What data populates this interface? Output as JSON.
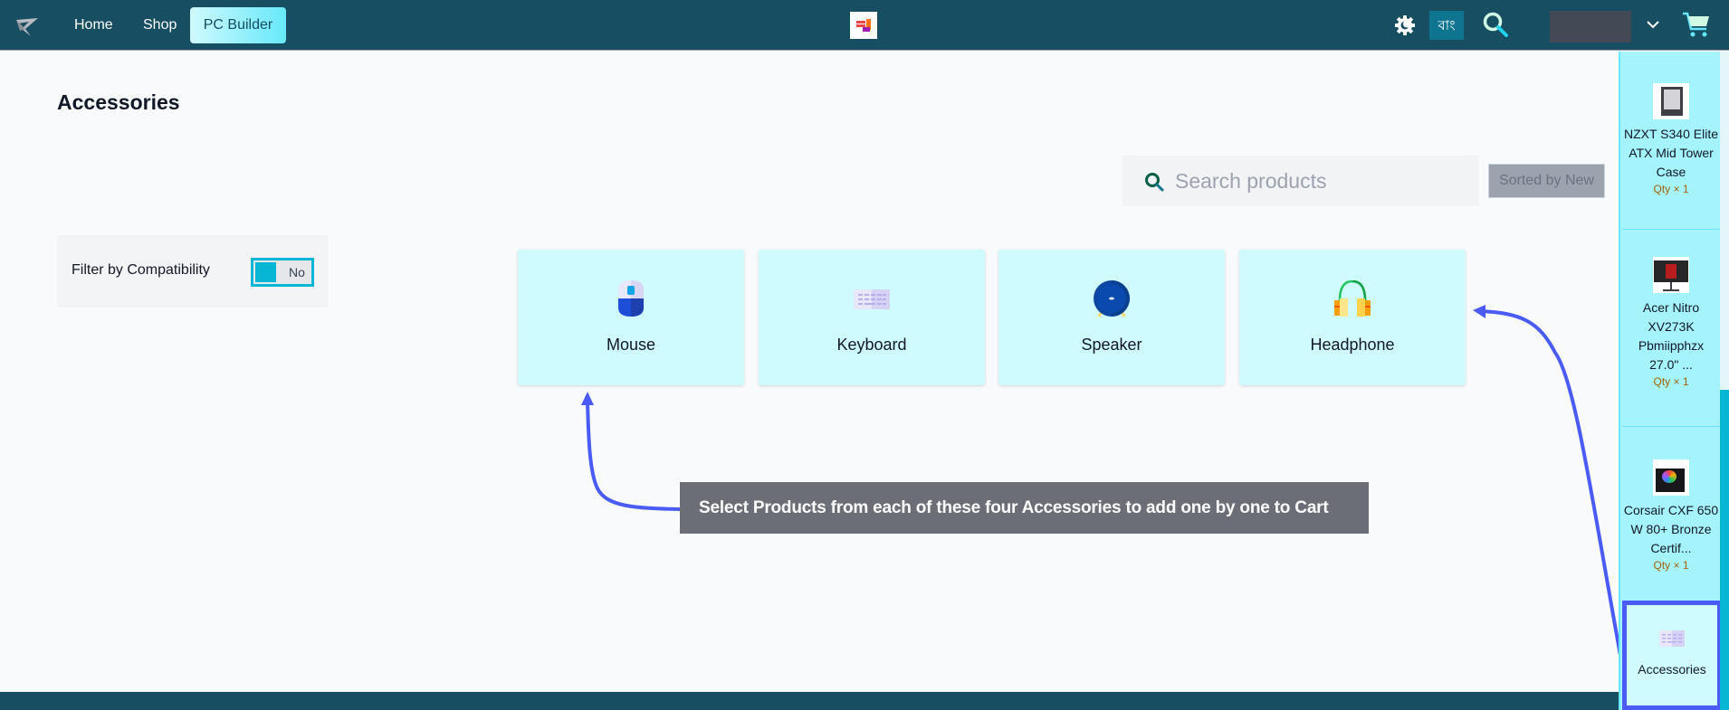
{
  "navbar": {
    "logo_icon": "brand-logo-icon",
    "links": [
      {
        "label": "Home",
        "active": false
      },
      {
        "label": "Shop",
        "active": false
      },
      {
        "label": "PC Builder",
        "active": true
      }
    ],
    "center_logo_icon": "store-logo-icon",
    "theme_icon": "theme-toggle-gear-icon",
    "language_button": "বাং",
    "search_icon": "search-icon",
    "user_menu_icon": "chevron-down-icon",
    "cart_icon": "cart-icon"
  },
  "main": {
    "title": "Accessories",
    "search": {
      "placeholder": "Search products",
      "value": ""
    },
    "sort_label": "Sorted by New",
    "filter": {
      "label": "Filter by Compatibility",
      "toggle_value": "No"
    },
    "categories": [
      {
        "label": "Mouse",
        "icon": "mouse-icon"
      },
      {
        "label": "Keyboard",
        "icon": "keyboard-icon"
      },
      {
        "label": "Speaker",
        "icon": "speaker-icon"
      },
      {
        "label": "Headphone",
        "icon": "headphone-icon"
      }
    ],
    "callout": "Select Products from each of these four Accessories to add one by one to Cart"
  },
  "sidebar": {
    "items": [
      {
        "name": "NZXT S340 Elite ATX Mid Tower Case",
        "qty": "Qty × 1"
      },
      {
        "name": "Acer Nitro XV273K Pbmiipphzx 27.0\" ...",
        "qty": "Qty × 1"
      },
      {
        "name": "Corsair CXF 650 W 80+ Bronze Certif...",
        "qty": "Qty × 1"
      }
    ],
    "active_category": {
      "label": "Accessories",
      "icon": "keyboard-icon"
    }
  },
  "colors": {
    "navbar": "#174e62",
    "accent": "#06b6d4",
    "card_bg": "#cffafe",
    "sidebar_bg": "#a5f3fc",
    "annotation": "#4a5cf5",
    "callout_bg": "#6b6e76"
  }
}
